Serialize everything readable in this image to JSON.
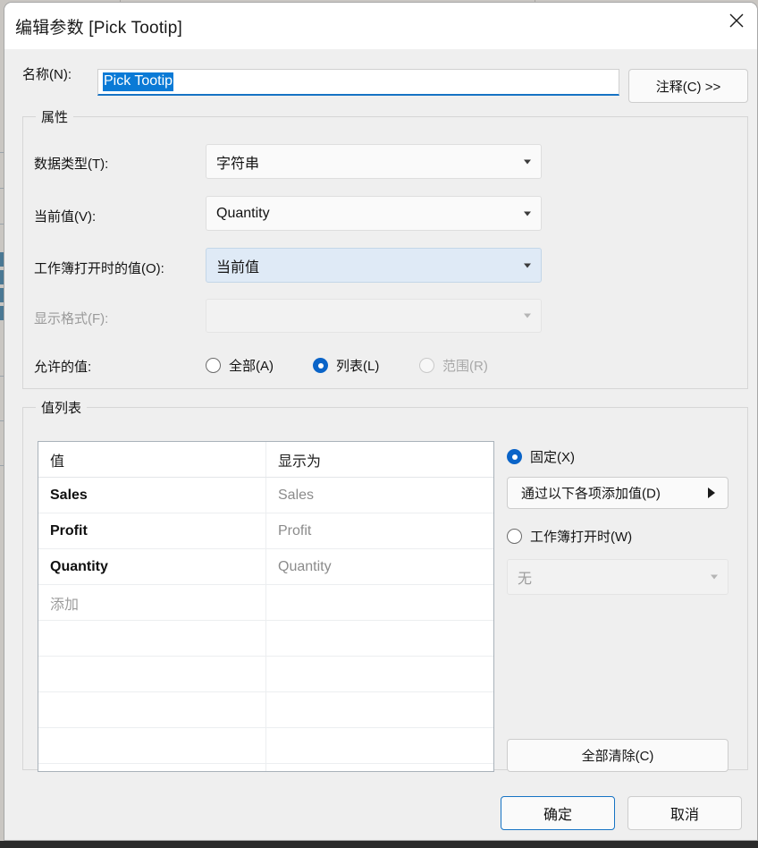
{
  "window": {
    "title": "编辑参数 [Pick Tootip]",
    "close_icon": "close-icon"
  },
  "name_row": {
    "label": "名称(N):",
    "value": "Pick Tootip",
    "comment_button": "注释(C) >>"
  },
  "properties": {
    "legend": "属性",
    "data_type": {
      "label": "数据类型(T):",
      "value": "字符串"
    },
    "current_value": {
      "label": "当前值(V):",
      "value": "Quantity"
    },
    "value_on_open": {
      "label": "工作簿打开时的值(O):",
      "value": "当前值"
    },
    "display_format": {
      "label": "显示格式(F):",
      "value": ""
    },
    "allowed_values": {
      "label": "允许的值:",
      "options": [
        {
          "label": "全部(A)",
          "checked": false,
          "disabled": false
        },
        {
          "label": "列表(L)",
          "checked": true,
          "disabled": false
        },
        {
          "label": "范围(R)",
          "checked": false,
          "disabled": true
        }
      ]
    }
  },
  "value_list": {
    "legend": "值列表",
    "columns": [
      "值",
      "显示为"
    ],
    "rows": [
      {
        "value": "Sales",
        "display": "Sales"
      },
      {
        "value": "Profit",
        "display": "Profit"
      },
      {
        "value": "Quantity",
        "display": "Quantity"
      }
    ],
    "add_placeholder": "添加",
    "empty_row_count": 5,
    "source_options": [
      {
        "label": "固定(X)",
        "checked": true,
        "disabled": false
      },
      {
        "label": "工作簿打开时(W)",
        "checked": false,
        "disabled": false
      }
    ],
    "add_values_button": "通过以下各项添加值(D)",
    "add_values_arrow_icon": "caret-right-icon",
    "workbook_combo_value": "无",
    "clear_all_button": "全部清除(C)"
  },
  "footer": {
    "ok": "确定",
    "cancel": "取消"
  },
  "colors": {
    "accent": "#1673c4",
    "radio_checked": "#0a64c8",
    "selection": "#0a7ad6",
    "dialog_bg": "#efefef",
    "titlebar_bg": "#ffffff",
    "combo_hover": "#dfeaf6"
  }
}
